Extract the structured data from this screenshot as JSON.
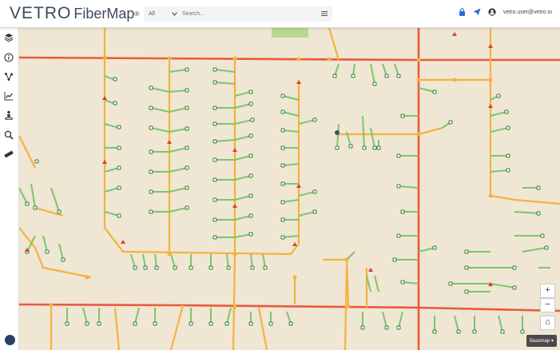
{
  "app": {
    "logo_text": "VETRO",
    "product": "FiberMap",
    "reg": "®"
  },
  "search": {
    "scope_value": "All",
    "placeholder": "Search..."
  },
  "header": {
    "user_email": "vetro.user@vetro.io"
  },
  "sidebar": {
    "items": [
      {
        "icon": "layers-icon"
      },
      {
        "icon": "info-icon"
      },
      {
        "icon": "network-icon"
      },
      {
        "icon": "chart-icon"
      },
      {
        "icon": "user-location-icon"
      },
      {
        "icon": "zoom-search-icon"
      },
      {
        "icon": "measure-icon"
      }
    ]
  },
  "map_controls": {
    "zoom_in": "+",
    "zoom_out": "−",
    "home": "⌂",
    "basemap_label": "Basemap ▾"
  },
  "colors": {
    "background": "#efe6d3",
    "road_major": "#e85a3c",
    "road_minor": "#f5b23c",
    "fiber_drop": "#7cc66a",
    "node": "#2f7a3c",
    "splice": "#d9412b"
  }
}
